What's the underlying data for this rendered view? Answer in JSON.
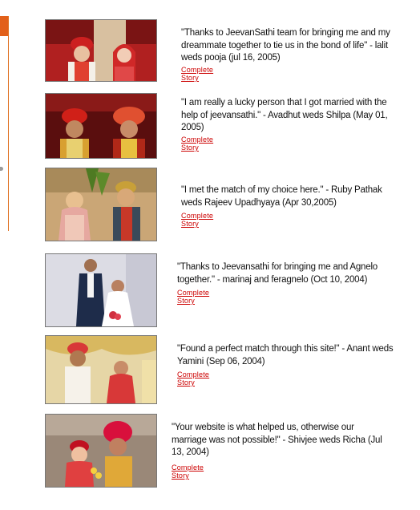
{
  "stories": [
    {
      "quote": "\"Thanks to JeevanSathi team for bringing me and my dreammate together to tie us in the bond of life\" - lalit weds pooja (jul 16, 2005)",
      "link": "Complete Story",
      "photo_icon": "couple-photo",
      "photo_colors": [
        "#8e1a1a",
        "#f2d2b8",
        "#ffffff",
        "#3a2a1a"
      ]
    },
    {
      "quote": "\"I am really a lucky person that I got married with the help of jeevansathi.\" - Avadhut weds Shilpa (May 01, 2005)",
      "link": "Complete Story",
      "photo_icon": "couple-photo",
      "photo_colors": [
        "#6b1010",
        "#d9a070",
        "#e8c040",
        "#2a1a10"
      ]
    },
    {
      "quote": "\"I met the match of my choice here.\" - Ruby Pathak weds Rajeev Upadhyaya (Apr 30,2005)",
      "link": "Complete Story",
      "photo_icon": "couple-photo",
      "photo_colors": [
        "#c8a070",
        "#5a7a2a",
        "#e6c090",
        "#b03a30"
      ]
    },
    {
      "quote": "\"Thanks to Jeevansathi for bringing me and Agnelo together.\" - marinaj and feragnelo (Oct 10, 2004)",
      "link": "Complete Story",
      "photo_icon": "couple-photo",
      "photo_colors": [
        "#dcdce6",
        "#20304a",
        "#ffffff",
        "#c08060"
      ]
    },
    {
      "quote": "\"Found a perfect match through this site!\" - Anant weds Yamini (Sep 06, 2004)",
      "link": "Complete Story",
      "photo_icon": "couple-photo",
      "photo_colors": [
        "#e8d8a0",
        "#d04040",
        "#ffffff",
        "#6a4a2a"
      ]
    },
    {
      "quote": "\"Your website is what helped us, otherwise our marriage was not possible!\" - Shivjee weds Richa (Jul 13, 2004)",
      "link": "Complete Story",
      "photo_icon": "couple-photo",
      "photo_colors": [
        "#9a8878",
        "#c01020",
        "#e8b850",
        "#f0c8a0"
      ]
    }
  ]
}
